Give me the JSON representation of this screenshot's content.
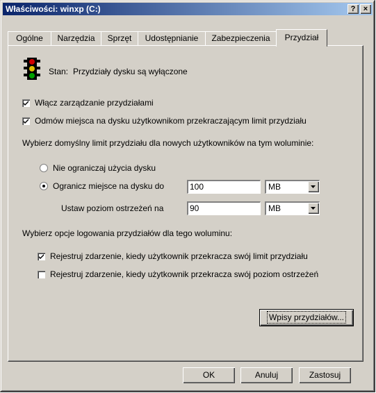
{
  "window": {
    "title": "Właściwości: winxp (C:)",
    "help_glyph": "?",
    "close_glyph": "×"
  },
  "tabs": [
    {
      "label": "Ogólne"
    },
    {
      "label": "Narzędzia"
    },
    {
      "label": "Sprzęt"
    },
    {
      "label": "Udostępnianie"
    },
    {
      "label": "Zabezpieczenia"
    },
    {
      "label": "Przydział",
      "active": true
    }
  ],
  "status": {
    "icon": "traffic-light-icon",
    "label": "Stan:",
    "text": "Przydziały dysku są wyłączone"
  },
  "options": {
    "enable_quota": {
      "label": "Włącz zarządzanie przydziałami",
      "checked": true
    },
    "deny_space": {
      "label": "Odmów miejsca na dysku użytkownikom przekraczającym limit przydziału",
      "checked": true
    }
  },
  "default_limit": {
    "heading": "Wybierz domyślny limit przydziału dla nowych użytkowników na tym woluminie:",
    "no_limit_label": "Nie ograniczaj użycia dysku",
    "limit_label": "Ogranicz miejsce na dysku do",
    "limit_value": "100",
    "limit_unit": "MB",
    "warning_label": "Ustaw poziom ostrzeżeń na",
    "warning_value": "90",
    "warning_unit": "MB",
    "selected": "limit"
  },
  "logging": {
    "heading": "Wybierz opcje logowania przydziałów dla tego woluminu:",
    "log_limit": {
      "label": "Rejestruj zdarzenie, kiedy użytkownik przekracza swój limit przydziału",
      "checked": true
    },
    "log_warning": {
      "label": "Rejestruj zdarzenie, kiedy użytkownik przekracza swój poziom ostrzeżeń",
      "checked": false
    }
  },
  "buttons": {
    "entries": "Wpisy przydziałów...",
    "ok": "OK",
    "cancel": "Anuluj",
    "apply": "Zastosuj"
  }
}
